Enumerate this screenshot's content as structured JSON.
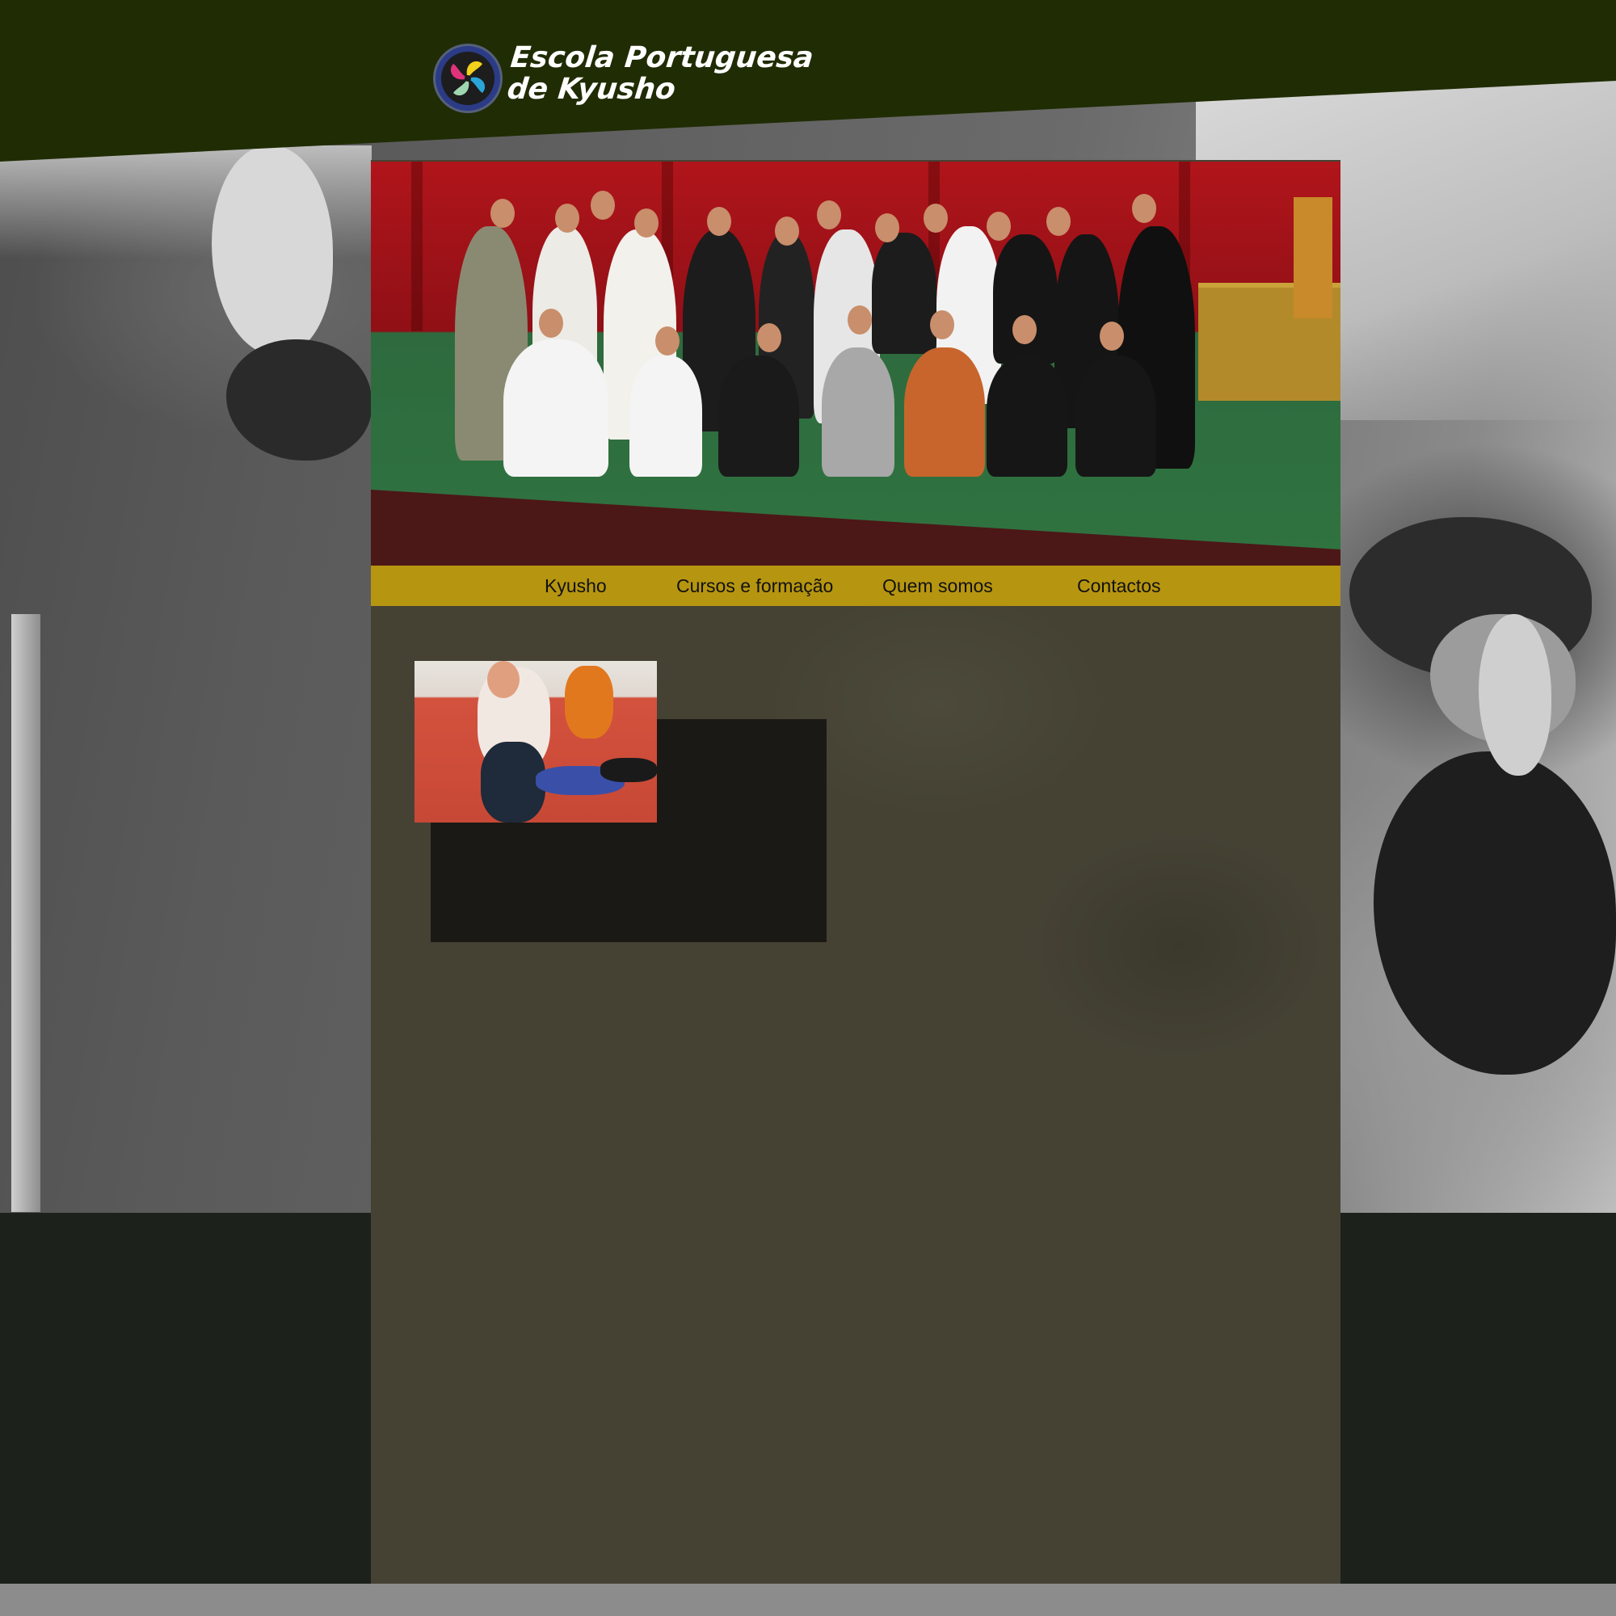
{
  "site": {
    "title": "Escola Portuguesa de Kyusho",
    "logo_icon": "kyusho-emblem-icon"
  },
  "banner": {
    "image": "group-photo"
  },
  "nav": {
    "items": [
      {
        "label": "Kyusho"
      },
      {
        "label": "Cursos e formação"
      },
      {
        "label": "Quem somos"
      },
      {
        "label": "Contactos"
      }
    ]
  },
  "content": {
    "thumbnail": "training-photo"
  },
  "colors": {
    "header": "#202c04",
    "banner_band": "#4c1717",
    "nav": "#b69510",
    "column": "#454234",
    "page_bg": "#1c211b",
    "footer": "#8c8c8c"
  }
}
